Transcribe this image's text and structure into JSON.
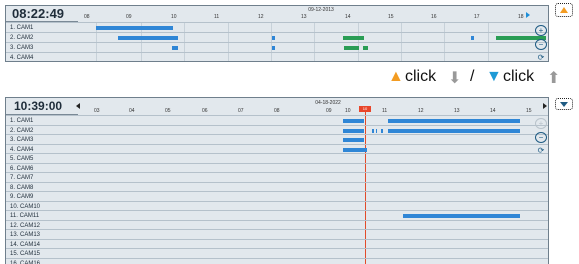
{
  "top_panel": {
    "clock": "08:22:49",
    "date": "09-12-2013",
    "hours": [
      "08",
      "09",
      "10",
      "11",
      "12",
      "13",
      "14",
      "15",
      "16",
      "17",
      "18"
    ],
    "cameras": [
      "1. CAM1",
      "2. CAM2",
      "3. CAM3",
      "4. CAM4"
    ]
  },
  "legend": {
    "up_glyph": "▲",
    "up_word": "click",
    "up_arrow": "⬇",
    "slash": "/",
    "down_glyph": "▼",
    "down_word": "click",
    "down_arrow": "⬆"
  },
  "bottom_panel": {
    "clock": "10:39:00",
    "date_line1": "04-18-2022",
    "date_line2": "09",
    "cursor_label": "10",
    "hours": [
      "03",
      "04",
      "05",
      "06",
      "07",
      "08",
      "09",
      "10",
      "11",
      "12",
      "13",
      "14",
      "15"
    ],
    "cameras": [
      "1. CAM1",
      "2. CAM2",
      "3. CAM3",
      "4. CAM4",
      "5. CAM5",
      "6. CAM6",
      "7. CAM7",
      "8. CAM8",
      "9. CAM9",
      "10. CAM10",
      "11. CAM11",
      "12. CAM12",
      "13. CAM13",
      "14. CAM14",
      "15. CAM15",
      "16. CAM16"
    ]
  },
  "colors": {
    "record": "#2f86d6",
    "motion": "#2a9d55",
    "event": "#e24b2a",
    "accent": "#1e5b83"
  }
}
